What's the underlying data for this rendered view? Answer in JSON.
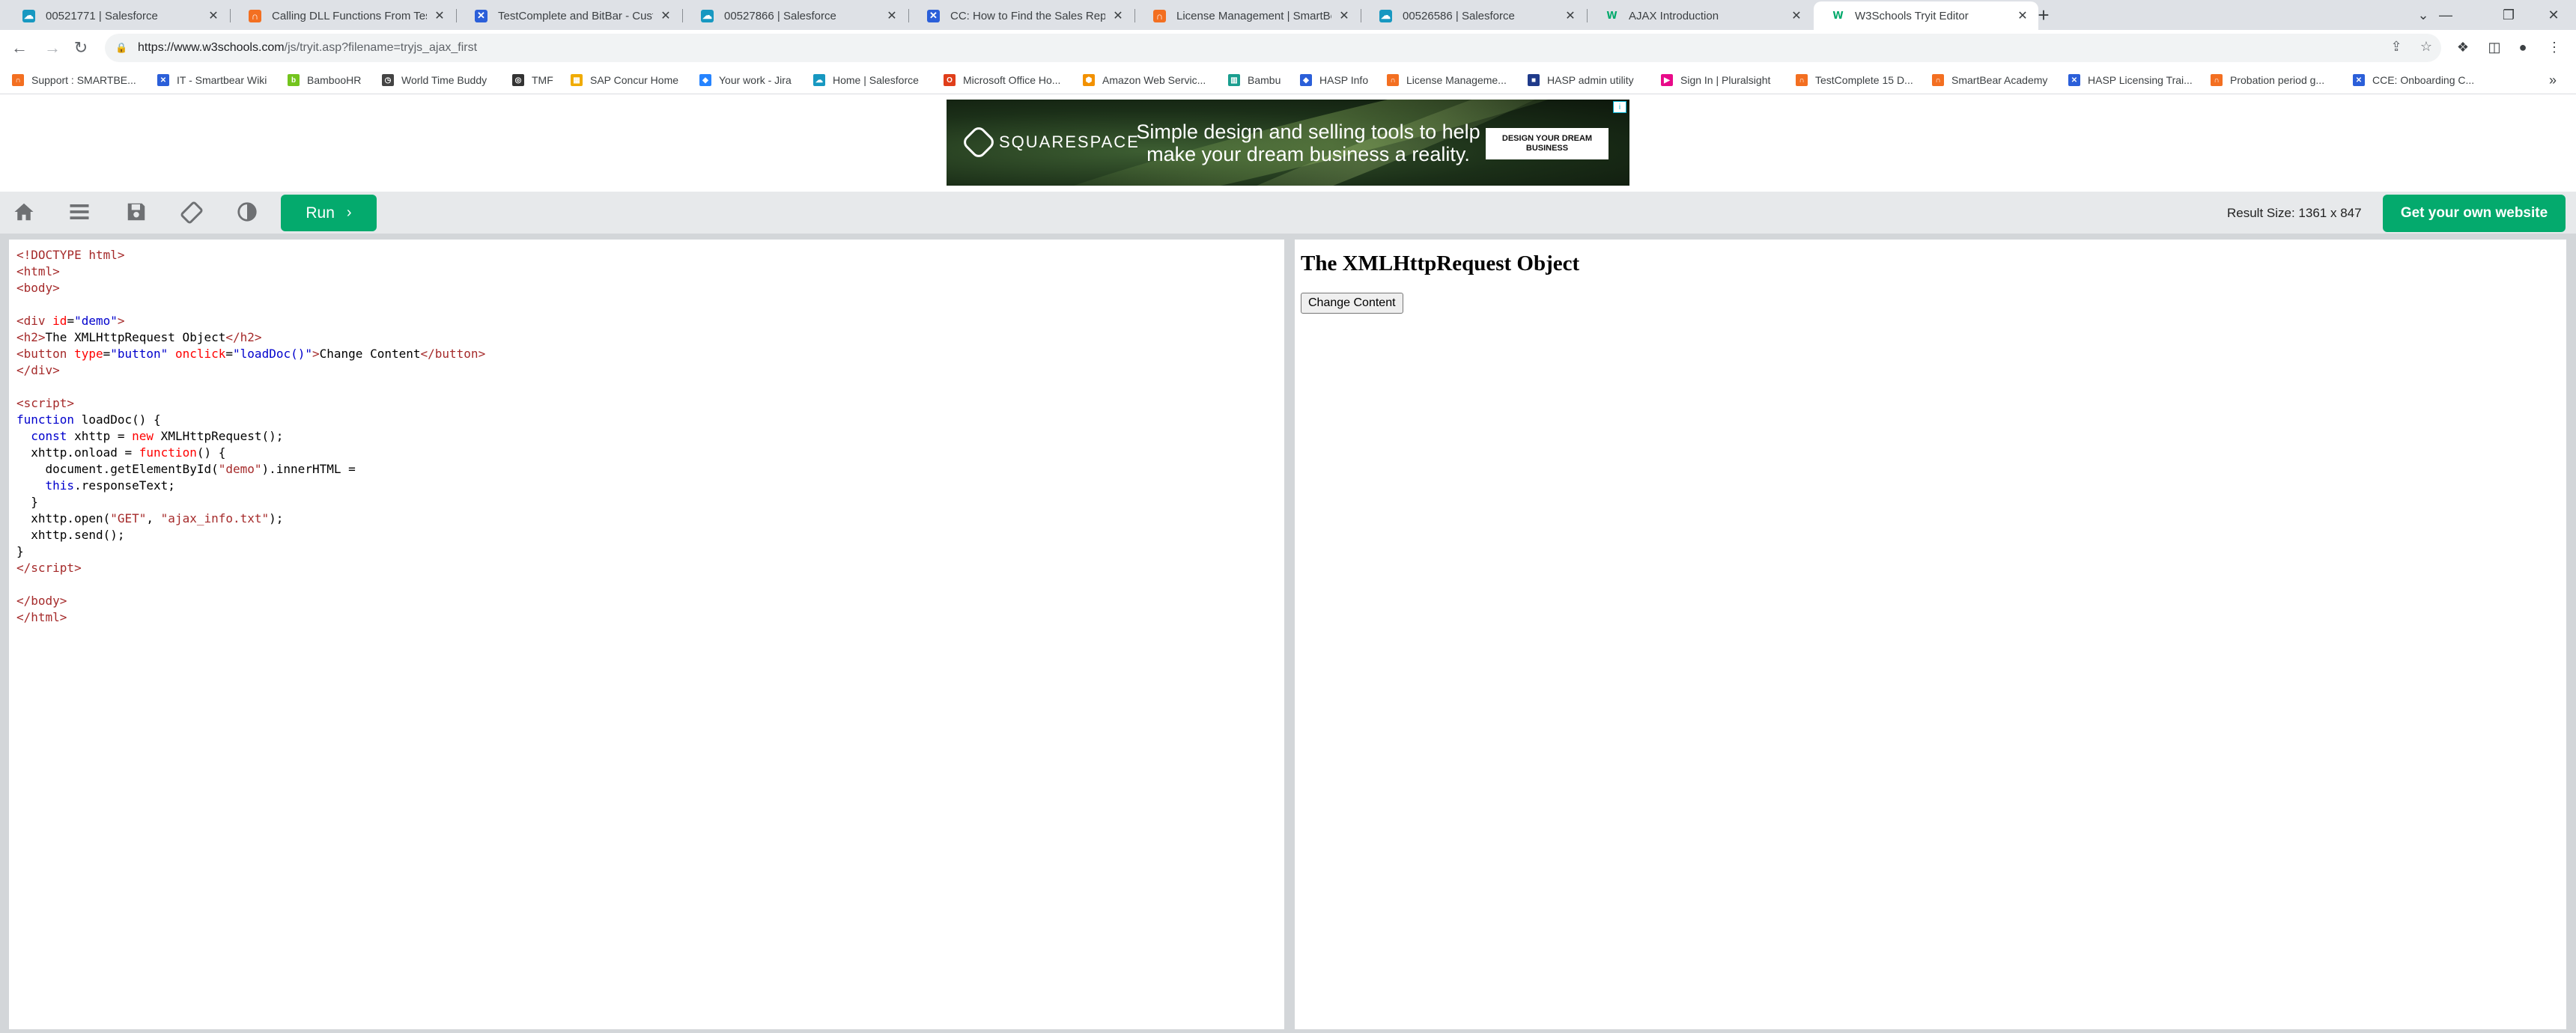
{
  "browser": {
    "tabs": [
      {
        "title": "00521771 | Salesforce",
        "favicon": "salesforce-icon"
      },
      {
        "title": "Calling DLL Functions From TestComplete",
        "favicon": "smartbear-icon"
      },
      {
        "title": "TestComplete and BitBar - Custom",
        "favicon": "testcomplete-icon"
      },
      {
        "title": "00527866 | Salesforce",
        "favicon": "salesforce-icon"
      },
      {
        "title": "CC: How to Find the Sales Rep to",
        "favicon": "testcomplete-icon"
      },
      {
        "title": "License Management | SmartBear",
        "favicon": "smartbear-icon"
      },
      {
        "title": "00526586 | Salesforce",
        "favicon": "salesforce-icon"
      },
      {
        "title": "AJAX Introduction",
        "favicon": "w3schools-icon"
      },
      {
        "title": "W3Schools Tryit Editor",
        "favicon": "w3schools-icon",
        "active": true
      }
    ],
    "new_tab": "+",
    "window_controls": {
      "tab_search": "⌄",
      "minimize": "—",
      "restore": "❐",
      "close": "✕"
    },
    "nav": {
      "back": "←",
      "forward": "→",
      "reload": "↻"
    },
    "address": {
      "host": "https://www.w3schools.com",
      "path": "/js/tryit.asp?filename=tryjs_ajax_first"
    },
    "bookmarks": [
      {
        "label": "Support : SMARTBE...",
        "icon": "smartbear-icon",
        "color": "#f36f21"
      },
      {
        "label": "IT - Smartbear Wiki",
        "icon": "confluence-icon",
        "color": "#2b5fd9"
      },
      {
        "label": "BambooHR",
        "icon": "bamboohr-icon",
        "color": "#73c41d"
      },
      {
        "label": "World Time Buddy",
        "icon": "clock-icon",
        "color": "#444444"
      },
      {
        "label": "TMF",
        "icon": "globe-icon",
        "color": "#333333"
      },
      {
        "label": "SAP Concur Home",
        "icon": "concur-icon",
        "color": "#f0ab00"
      },
      {
        "label": "Your work - Jira",
        "icon": "jira-icon",
        "color": "#2684ff"
      },
      {
        "label": "Home | Salesforce",
        "icon": "salesforce-icon",
        "color": "#1798c1"
      },
      {
        "label": "Microsoft Office Ho...",
        "icon": "office-icon",
        "color": "#e03e1a"
      },
      {
        "label": "Amazon Web Servic...",
        "icon": "aws-icon",
        "color": "#f29100"
      },
      {
        "label": "Bambu",
        "icon": "bambu-icon",
        "color": "#1a9e8f"
      },
      {
        "label": "HASP Info",
        "icon": "hasp-icon",
        "color": "#2b5fd9"
      },
      {
        "label": "License Manageme...",
        "icon": "smartbear-icon",
        "color": "#f36f21"
      },
      {
        "label": "HASP admin utility",
        "icon": "hasp-admin-icon",
        "color": "#1f3a8a"
      },
      {
        "label": "Sign In | Pluralsight",
        "icon": "pluralsight-icon",
        "color": "#e80a89"
      },
      {
        "label": "TestComplete 15 D...",
        "icon": "smartbear-icon",
        "color": "#f36f21"
      },
      {
        "label": "SmartBear Academy",
        "icon": "smartbear-icon",
        "color": "#f36f21"
      },
      {
        "label": "HASP Licensing Trai...",
        "icon": "confluence-icon",
        "color": "#2b5fd9"
      },
      {
        "label": "Probation period g...",
        "icon": "smartbear-icon",
        "color": "#f36f21"
      },
      {
        "label": "CCE: Onboarding C...",
        "icon": "confluence-icon",
        "color": "#2b5fd9"
      }
    ],
    "bookmarks_more": "»"
  },
  "ad": {
    "brand": "SQUARESPACE",
    "headline": "Simple design and selling tools to help make your dream business a reality.",
    "cta": "DESIGN YOUR DREAM BUSINESS",
    "badge": "i"
  },
  "tryit": {
    "run_label": "Run",
    "run_chevron": "›",
    "result_size": "Result Size: 1361 x 847",
    "get_website": "Get your own website",
    "icons": [
      "home-icon",
      "menu-icon",
      "save-icon",
      "rotate-icon",
      "contrast-icon"
    ]
  },
  "result": {
    "heading": "The XMLHttpRequest Object",
    "button": "Change Content"
  },
  "colors": {
    "accent": "#04aa6d",
    "toolbar_bg": "#e7e9eb"
  }
}
